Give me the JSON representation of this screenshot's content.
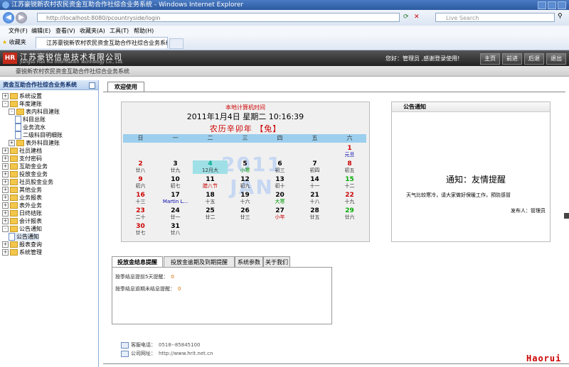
{
  "browser": {
    "window_title": "江苏豪锐新农村农民资金互助合作社综合业务系统 - Windows Internet Explorer",
    "url": "http://localhost:8080/pcountryside/login",
    "search_placeholder": "Live Search",
    "menu": [
      "文件(F)",
      "编辑(E)",
      "查看(V)",
      "收藏夹(A)",
      "工具(T)",
      "帮助(H)"
    ],
    "favorites_label": "收藏夹",
    "tab_title": "江苏豪锐新农村农民资金互助合作社综合业务系统"
  },
  "header": {
    "logo": "HR",
    "company_name": "江苏豪锐信息技术有限公司",
    "company_name_en": "Jiangsu Hao Rui Information Technology Co., Ltd.",
    "user_info": "您好：管理员 ,感谢登录使用!",
    "nav": [
      "主页",
      "前进",
      "后退",
      "退出"
    ],
    "system_title": "豪锐新农村农民资金互助合作社综合业务系统"
  },
  "sidebar": {
    "title": "资金互助合作社综合业务系统",
    "items": [
      {
        "label": "系统设置",
        "level": 0,
        "kind": "plus"
      },
      {
        "label": "年度建账",
        "level": 0,
        "kind": "minus"
      },
      {
        "label": "表内科目建账",
        "level": 1,
        "kind": "minus"
      },
      {
        "label": "科目总账",
        "level": 2,
        "kind": "doc"
      },
      {
        "label": "业务流水",
        "level": 2,
        "kind": "doc"
      },
      {
        "label": "二级科目明细账",
        "level": 2,
        "kind": "doc"
      },
      {
        "label": "表外科目建账",
        "level": 1,
        "kind": "plus"
      },
      {
        "label": "社员建档",
        "level": 0,
        "kind": "plus"
      },
      {
        "label": "支付密码",
        "level": 0,
        "kind": "plus"
      },
      {
        "label": "互助金业务",
        "level": 0,
        "kind": "plus"
      },
      {
        "label": "投放金业务",
        "level": 0,
        "kind": "plus"
      },
      {
        "label": "社员股金业务",
        "level": 0,
        "kind": "plus"
      },
      {
        "label": "其他业务",
        "level": 0,
        "kind": "plus"
      },
      {
        "label": "业务报表",
        "level": 0,
        "kind": "plus"
      },
      {
        "label": "表外业务",
        "level": 0,
        "kind": "plus"
      },
      {
        "label": "日终结账",
        "level": 0,
        "kind": "plus"
      },
      {
        "label": "会计报表",
        "level": 0,
        "kind": "plus"
      },
      {
        "label": "公告通知",
        "level": 0,
        "kind": "minus"
      },
      {
        "label": "公告通知",
        "level": 1,
        "kind": "doc",
        "selected": true
      },
      {
        "label": "报表查询",
        "level": 0,
        "kind": "plus"
      },
      {
        "label": "系统管理",
        "level": 0,
        "kind": "plus"
      }
    ]
  },
  "main": {
    "tab": "欢迎使用"
  },
  "calendar": {
    "system_time_label": "本地计算机时间",
    "date_text": "2011年1月4日  星期二  10:16:39",
    "lunar_text": "农历辛卯年  【兔】",
    "weekdays": [
      "日",
      "一",
      "二",
      "三",
      "四",
      "五",
      "六"
    ],
    "watermark_year": "2011",
    "watermark_month": "JAN",
    "weeks": [
      [
        null,
        null,
        null,
        null,
        null,
        null,
        {
          "n": "1",
          "l": "元旦",
          "nc": "#c00",
          "lc": "#00a"
        }
      ],
      [
        {
          "n": "2",
          "l": "廿八",
          "nc": "#c00"
        },
        {
          "n": "3",
          "l": "廿九"
        },
        {
          "n": "4",
          "l": "12月大",
          "today": true,
          "nc": "#0a8"
        },
        {
          "n": "5",
          "l": "小寒",
          "lc": "#090"
        },
        {
          "n": "6",
          "l": "初三"
        },
        {
          "n": "7",
          "l": "初四"
        },
        {
          "n": "8",
          "l": "初五",
          "nc": "#c00"
        }
      ],
      [
        {
          "n": "9",
          "l": "初六",
          "nc": "#c00"
        },
        {
          "n": "10",
          "l": "初七"
        },
        {
          "n": "11",
          "l": "腊八节",
          "lc": "#c00"
        },
        {
          "n": "12",
          "l": "初九"
        },
        {
          "n": "13",
          "l": "初十"
        },
        {
          "n": "14",
          "l": "十一"
        },
        {
          "n": "15",
          "l": "十二",
          "nc": "#0a0"
        }
      ],
      [
        {
          "n": "16",
          "l": "十三",
          "nc": "#c00"
        },
        {
          "n": "17",
          "l": "Martin L...",
          "lc": "#00a"
        },
        {
          "n": "18",
          "l": "十五"
        },
        {
          "n": "19",
          "l": "十六"
        },
        {
          "n": "20",
          "l": "大寒",
          "lc": "#090"
        },
        {
          "n": "21",
          "l": "十八"
        },
        {
          "n": "22",
          "l": "十九",
          "nc": "#c00"
        }
      ],
      [
        {
          "n": "23",
          "l": "二十",
          "nc": "#c00"
        },
        {
          "n": "24",
          "l": "廿一"
        },
        {
          "n": "25",
          "l": "廿二"
        },
        {
          "n": "26",
          "l": "廿三"
        },
        {
          "n": "27",
          "l": "小年",
          "lc": "#c00"
        },
        {
          "n": "28",
          "l": "廿五"
        },
        {
          "n": "29",
          "l": "廿六",
          "nc": "#0a0"
        }
      ],
      [
        {
          "n": "30",
          "l": "廿七",
          "nc": "#c00"
        },
        {
          "n": "31",
          "l": "廿八"
        },
        null,
        null,
        null,
        null,
        null
      ]
    ]
  },
  "notice": {
    "header": "公告通知",
    "title": "通知：友情提醒",
    "body": "天气比较寒冷，请大家做好保暖工作，预防感冒",
    "signature": "发布人：管理员"
  },
  "reminders": {
    "tabs": [
      "投放金结息提醒",
      "投放金逾期及到期提醒",
      "系统参数",
      "关于我们"
    ],
    "lines": [
      {
        "label": "按季结息提前5天提醒：",
        "value": "0"
      },
      {
        "label": "按季结息逾期未结息提醒：",
        "value": "0"
      }
    ]
  },
  "footer": {
    "phone_label": "客服电话：",
    "phone": "0518--85845100",
    "site_label": "公司网址：",
    "site": "http://www.hrit.net.cn"
  },
  "brand": "Haorui"
}
